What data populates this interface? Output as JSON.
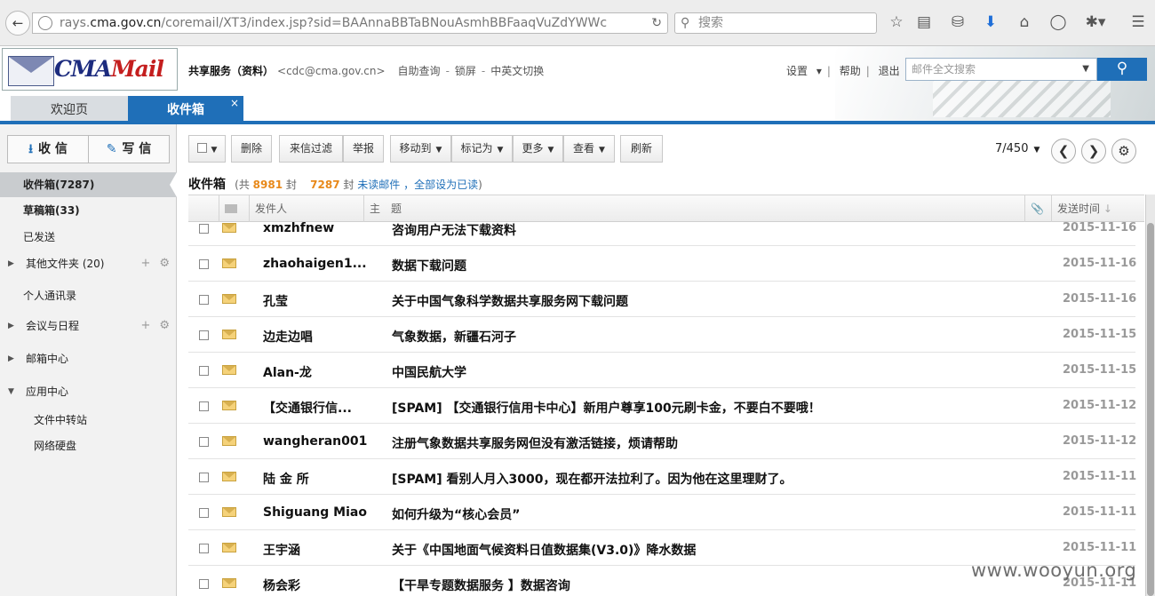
{
  "browser": {
    "url_prefix": "rays.",
    "url_host": "cma.gov.cn",
    "url_path": "/coremail/XT3/index.jsp?sid=BAAnnaBBTaBNouAsmhBBFaaqVuZdYWWc",
    "search_placeholder": "搜索"
  },
  "header": {
    "logo_text_a": "CMA",
    "logo_text_b": "Mail",
    "account_name": "共享服务（资料）",
    "account_email": "<cdc@cma.gov.cn>",
    "link_query": "自助查询",
    "link_lock": "锁屏",
    "link_lang": "中英文切换",
    "settings": "设置",
    "help": "帮助",
    "logout": "退出",
    "search_placeholder": "邮件全文搜索"
  },
  "tabs": {
    "welcome": "欢迎页",
    "inbox": "收件箱",
    "close": "×"
  },
  "sidebar": {
    "receive": "收 信",
    "write": "写 信",
    "items": [
      {
        "label": "收件箱(7287)"
      },
      {
        "label": "草稿箱(33)"
      },
      {
        "label": "已发送"
      },
      {
        "label": "其他文件夹 (20)"
      },
      {
        "label": "个人通讯录"
      },
      {
        "label": "会议与日程"
      },
      {
        "label": "邮箱中心"
      },
      {
        "label": "应用中心"
      },
      {
        "label": "文件中转站"
      },
      {
        "label": "网络硬盘"
      }
    ]
  },
  "toolbar": {
    "delete": "删除",
    "filter": "来信过滤",
    "report": "举报",
    "move": "移动到",
    "mark": "标记为",
    "more": "更多",
    "view": "查看",
    "refresh": "刷新",
    "pager": "7/450"
  },
  "folder": {
    "title": "收件箱",
    "total_prefix": "(共",
    "total": "8981",
    "unit1": "封",
    "unread": "7287",
    "unit2": "封",
    "unread_link": "未读邮件",
    "mark_all": "，全部设为已读",
    "close_paren": ")"
  },
  "columns": {
    "sender": "发件人",
    "subject": "主　题",
    "time": "发送时间"
  },
  "emails": [
    {
      "from": "xmzhfnew",
      "subject": "咨询用户无法下载资料",
      "date": "2015-11-16"
    },
    {
      "from": "zhaohaigen1...",
      "subject": "数据下载问题",
      "date": "2015-11-16"
    },
    {
      "from": "孔莹",
      "subject": "关于中国气象科学数据共享服务网下载问题",
      "date": "2015-11-16"
    },
    {
      "from": "边走边唱",
      "subject": "气象数据，新疆石河子",
      "date": "2015-11-15"
    },
    {
      "from": "Alan-龙",
      "subject": "中国民航大学",
      "date": "2015-11-15"
    },
    {
      "from": "【交通银行信...",
      "subject": "[SPAM] 【交通银行信用卡中心】新用户尊享100元刷卡金，不要白不要哦！",
      "date": "2015-11-12"
    },
    {
      "from": "wangheran001",
      "subject": "注册气象数据共享服务网但没有激活链接，烦请帮助",
      "date": "2015-11-12"
    },
    {
      "from": "陆 金 所",
      "subject": "[SPAM] 看别人月入3000，现在都开法拉利了。因为他在这里理财了。",
      "date": "2015-11-11"
    },
    {
      "from": "Shiguang Miao",
      "subject": "如何升级为“核心会员”",
      "date": "2015-11-11"
    },
    {
      "from": "王宇涵",
      "subject": "关于《中国地面气候资料日值数据集(V3.0)》降水数据",
      "date": "2015-11-11"
    },
    {
      "from": "杨会彩",
      "subject": "【干旱专题数据服务 】数据咨询",
      "date": "2015-11-11"
    }
  ],
  "watermark": "www.wooyun.org"
}
